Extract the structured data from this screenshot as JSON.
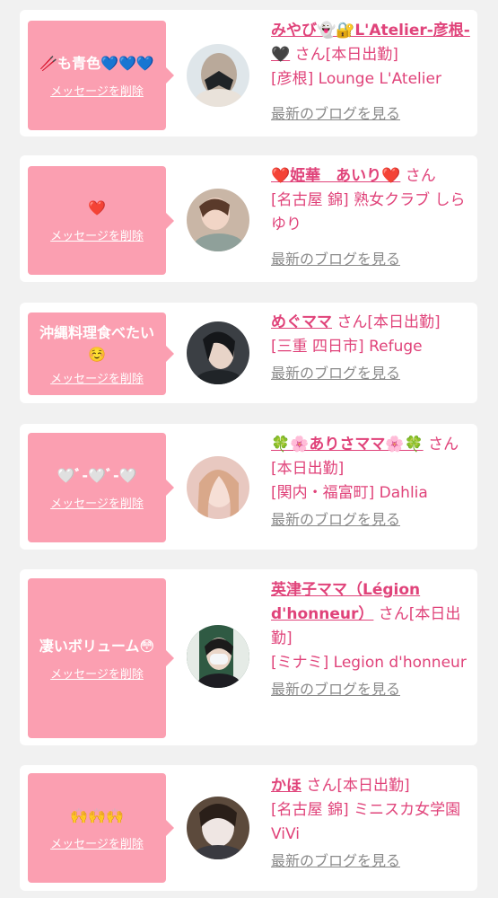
{
  "delete_label": "メッセージを削除",
  "blog_label": "最新のブログを見る",
  "colors": {
    "accent": "#e0437a",
    "bubble": "#fb9fb1",
    "background": "#f1f1f1"
  },
  "cards": [
    {
      "message": "🥢も青色💙💙💙",
      "name": "みやび👻🔐L'Atelier-彦根-🖤",
      "suffix": " さん[本日出勤]",
      "shop": "[彦根] Lounge L'Atelier"
    },
    {
      "message": "❤️",
      "name": "❤️姫華　あいり❤️",
      "suffix": " さん",
      "shop": "[名古屋 錦] 熟女クラブ しらゆり"
    },
    {
      "message": "沖縄料理食べたい☺️",
      "name": "めぐママ",
      "suffix": " さん[本日出勤]",
      "shop": "[三重 四日市] Refuge"
    },
    {
      "message": "🤍ﾞ-🤍ﾞ-🤍",
      "name": "🍀🌸ありさママ🌸🍀",
      "suffix": " さん[本日出勤]",
      "shop": "[関内・福富町] Dahlia"
    },
    {
      "message": "凄いボリューム😳",
      "name": "英津子ママ（Légion d'honneur）",
      "suffix": " さん[本日出勤]",
      "shop": "[ミナミ] Legion d'honneur"
    },
    {
      "message": "🙌🙌🙌",
      "name": "かほ",
      "suffix": " さん[本日出勤]",
      "shop": "[名古屋 錦] ミニスカ女学園ViVi"
    }
  ]
}
